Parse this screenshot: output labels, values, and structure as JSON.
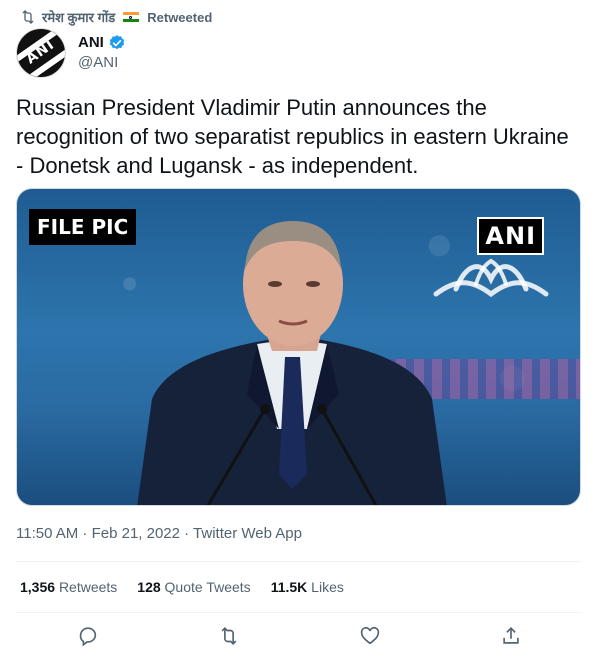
{
  "retweet_context": {
    "user": "रमेश कुमार गोंड",
    "label": "Retweeted"
  },
  "author": {
    "display_name": "ANI",
    "handle": "@ANI",
    "verified": true,
    "avatar_text": "ANI"
  },
  "tweet": {
    "text": "Russian President Vladimir Putin announces the recognition of two separatist republics in eastern Ukraine - Donetsk and Lugansk - as independent."
  },
  "media": {
    "overlay_left": "FILE PIC",
    "overlay_right": "ANI"
  },
  "meta": {
    "timestamp": "11:50 AM · Feb 21, 2022 · Twitter Web App"
  },
  "stats": {
    "retweets_count": "1,356",
    "retweets_label": "Retweets",
    "quotes_count": "128",
    "quotes_label": "Quote Tweets",
    "likes_count": "11.5K",
    "likes_label": "Likes"
  },
  "icons": {
    "retweet": "retweet-icon",
    "verified": "verified-badge-icon",
    "reply": "reply-icon",
    "like": "heart-icon",
    "share": "share-icon"
  },
  "colors": {
    "text_primary": "#0f1419",
    "text_secondary": "#536471",
    "verified_blue": "#1d9bf0"
  }
}
